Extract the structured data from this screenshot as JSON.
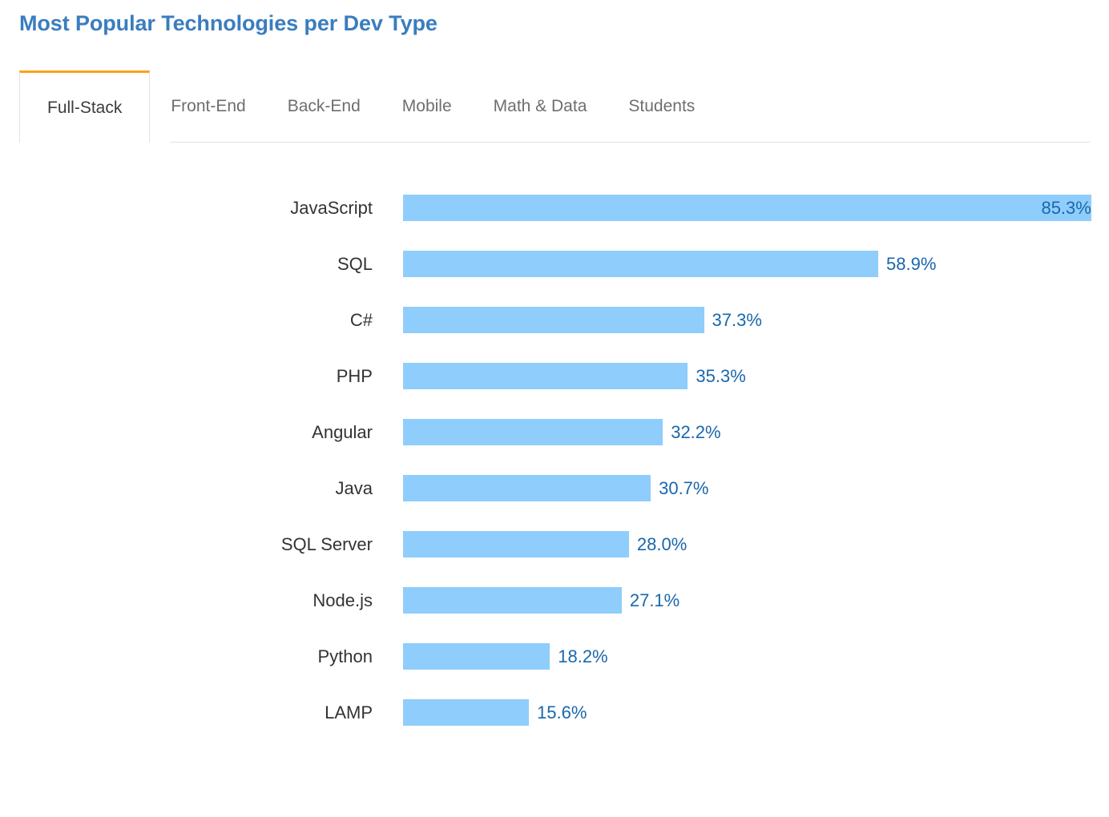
{
  "header": {
    "title": "Most Popular Technologies per Dev Type",
    "title_color": "#3a7dbf"
  },
  "tabs": {
    "active_index": 0,
    "active_indicator_color": "#f9a21b",
    "items": [
      {
        "label": "Full-Stack"
      },
      {
        "label": "Front-End"
      },
      {
        "label": "Back-End"
      },
      {
        "label": "Mobile"
      },
      {
        "label": "Math & Data"
      },
      {
        "label": "Students"
      }
    ]
  },
  "chart_data": {
    "type": "bar",
    "orientation": "horizontal",
    "title": "Most Popular Technologies per Dev Type",
    "subtitle": "Full-Stack",
    "xlabel": "",
    "ylabel": "",
    "xlim": [
      0,
      87.5
    ],
    "grid": false,
    "legend": false,
    "bar_color": "#8fcdfc",
    "value_label_color": "#1a67ab",
    "value_suffix": "%",
    "categories": [
      "JavaScript",
      "SQL",
      "C#",
      "PHP",
      "Angular",
      "Java",
      "SQL Server",
      "Node.js",
      "Python",
      "LAMP"
    ],
    "values": [
      85.3,
      58.9,
      37.3,
      35.3,
      32.2,
      30.7,
      28.0,
      27.1,
      18.2,
      15.6
    ],
    "value_labels": [
      "85.3%",
      "58.9%",
      "37.3%",
      "35.3%",
      "32.2%",
      "30.7%",
      "28.0%",
      "27.1%",
      "18.2%",
      "15.6%"
    ],
    "label_placement": [
      "inside",
      "outside",
      "outside",
      "outside",
      "outside",
      "outside",
      "outside",
      "outside",
      "outside",
      "outside"
    ]
  }
}
